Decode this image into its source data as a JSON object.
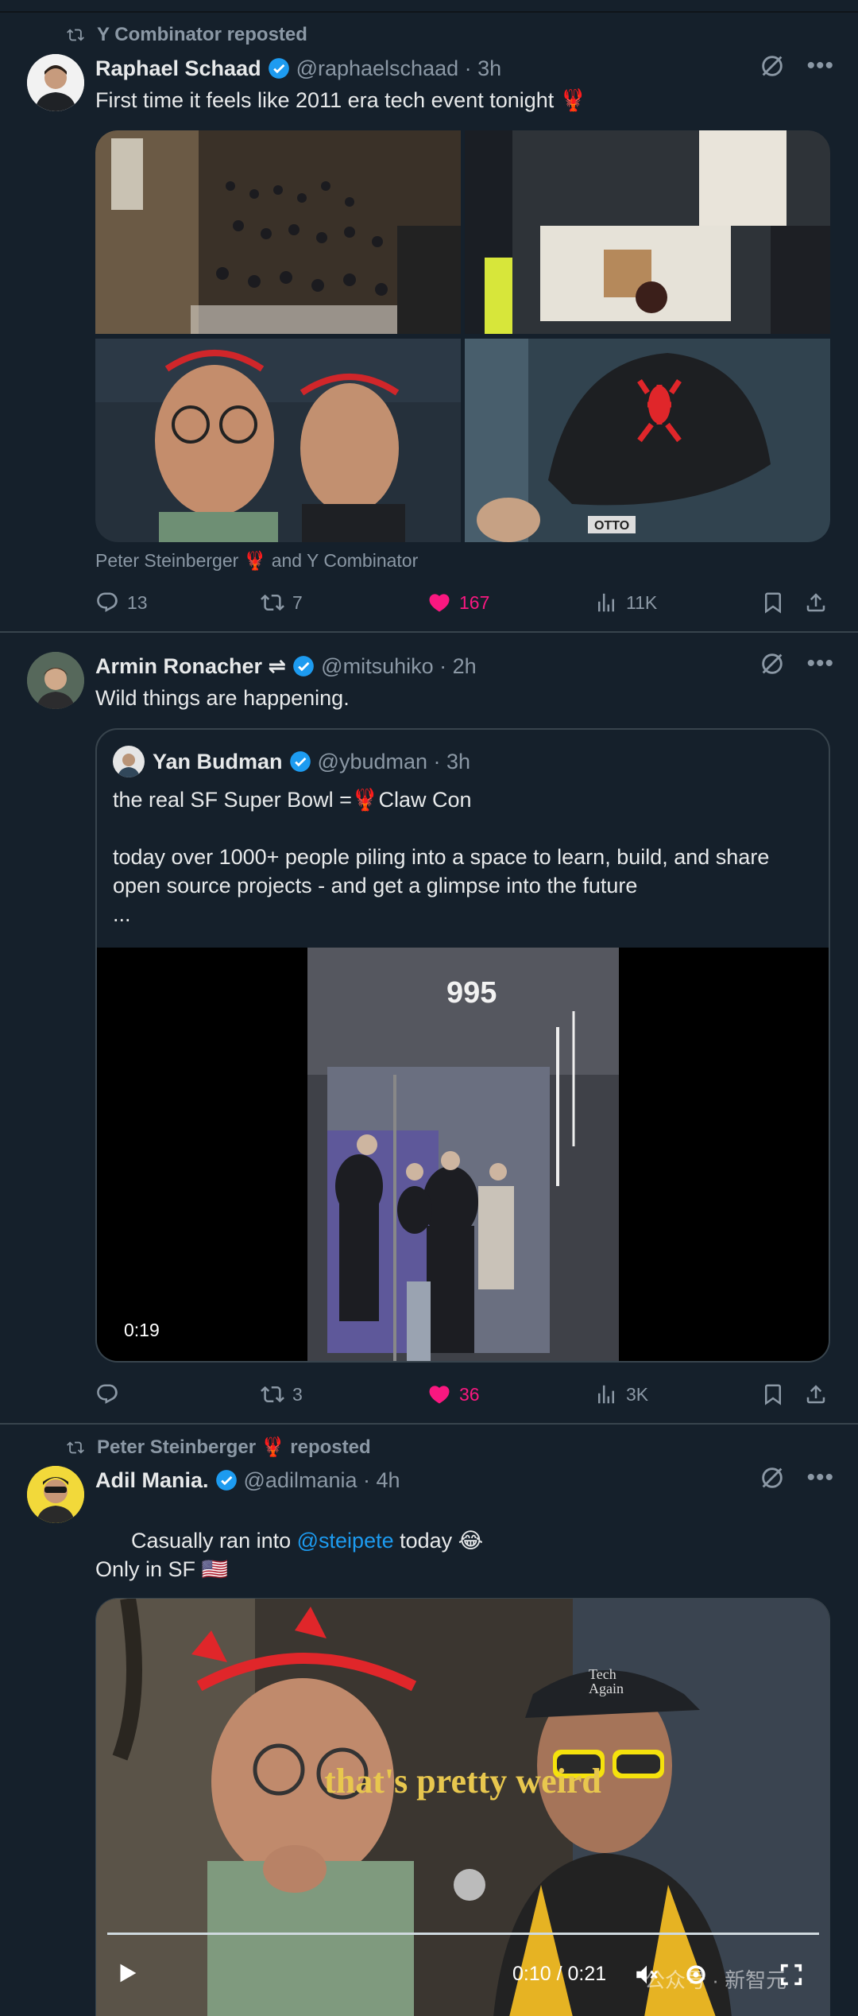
{
  "posts": [
    {
      "repost_by": "Y Combinator reposted",
      "name": "Raphael Schaad",
      "handle": "@raphaelschaad · 3h",
      "text": "First time it feels like 2011 era tech event tonight 🦞",
      "caption": "Peter Steinberger 🦞 and Y Combinator",
      "replies": "13",
      "reposts": "7",
      "likes": "167",
      "views": "11K"
    },
    {
      "name": "Armin Ronacher ⇌",
      "handle": "@mitsuhiko · 2h",
      "text": "Wild things are happening.",
      "quote": {
        "name": "Yan Budman",
        "handle": "@ybudman · 3h",
        "text": "the real SF Super Bowl =🦞Claw Con\n\ntoday over 1000+ people piling into a space to learn, build, and share open source projects - and get a glimpse into the future\n...",
        "video_number": "995",
        "video_time": "0:19"
      },
      "replies": "",
      "reposts": "3",
      "likes": "36",
      "views": "3K"
    },
    {
      "repost_by": "Peter Steinberger 🦞 reposted",
      "name": "Adil Mania.",
      "handle": "@adilmania · 4h",
      "text_before": "Casually ran into ",
      "mention": "@steipete",
      "text_after": " today 😂",
      "text2": "Only in SF 🇺🇸",
      "video_subtitle": "that's pretty weird",
      "video_time": "0:10 / 0:21",
      "cap_text": "Tech Again",
      "watermark": "公众号 · 新智元"
    }
  ],
  "colors": {
    "accent": "#1d9bf0",
    "like": "#f91880",
    "muted": "#8b98a5",
    "bg": "#15202b"
  }
}
